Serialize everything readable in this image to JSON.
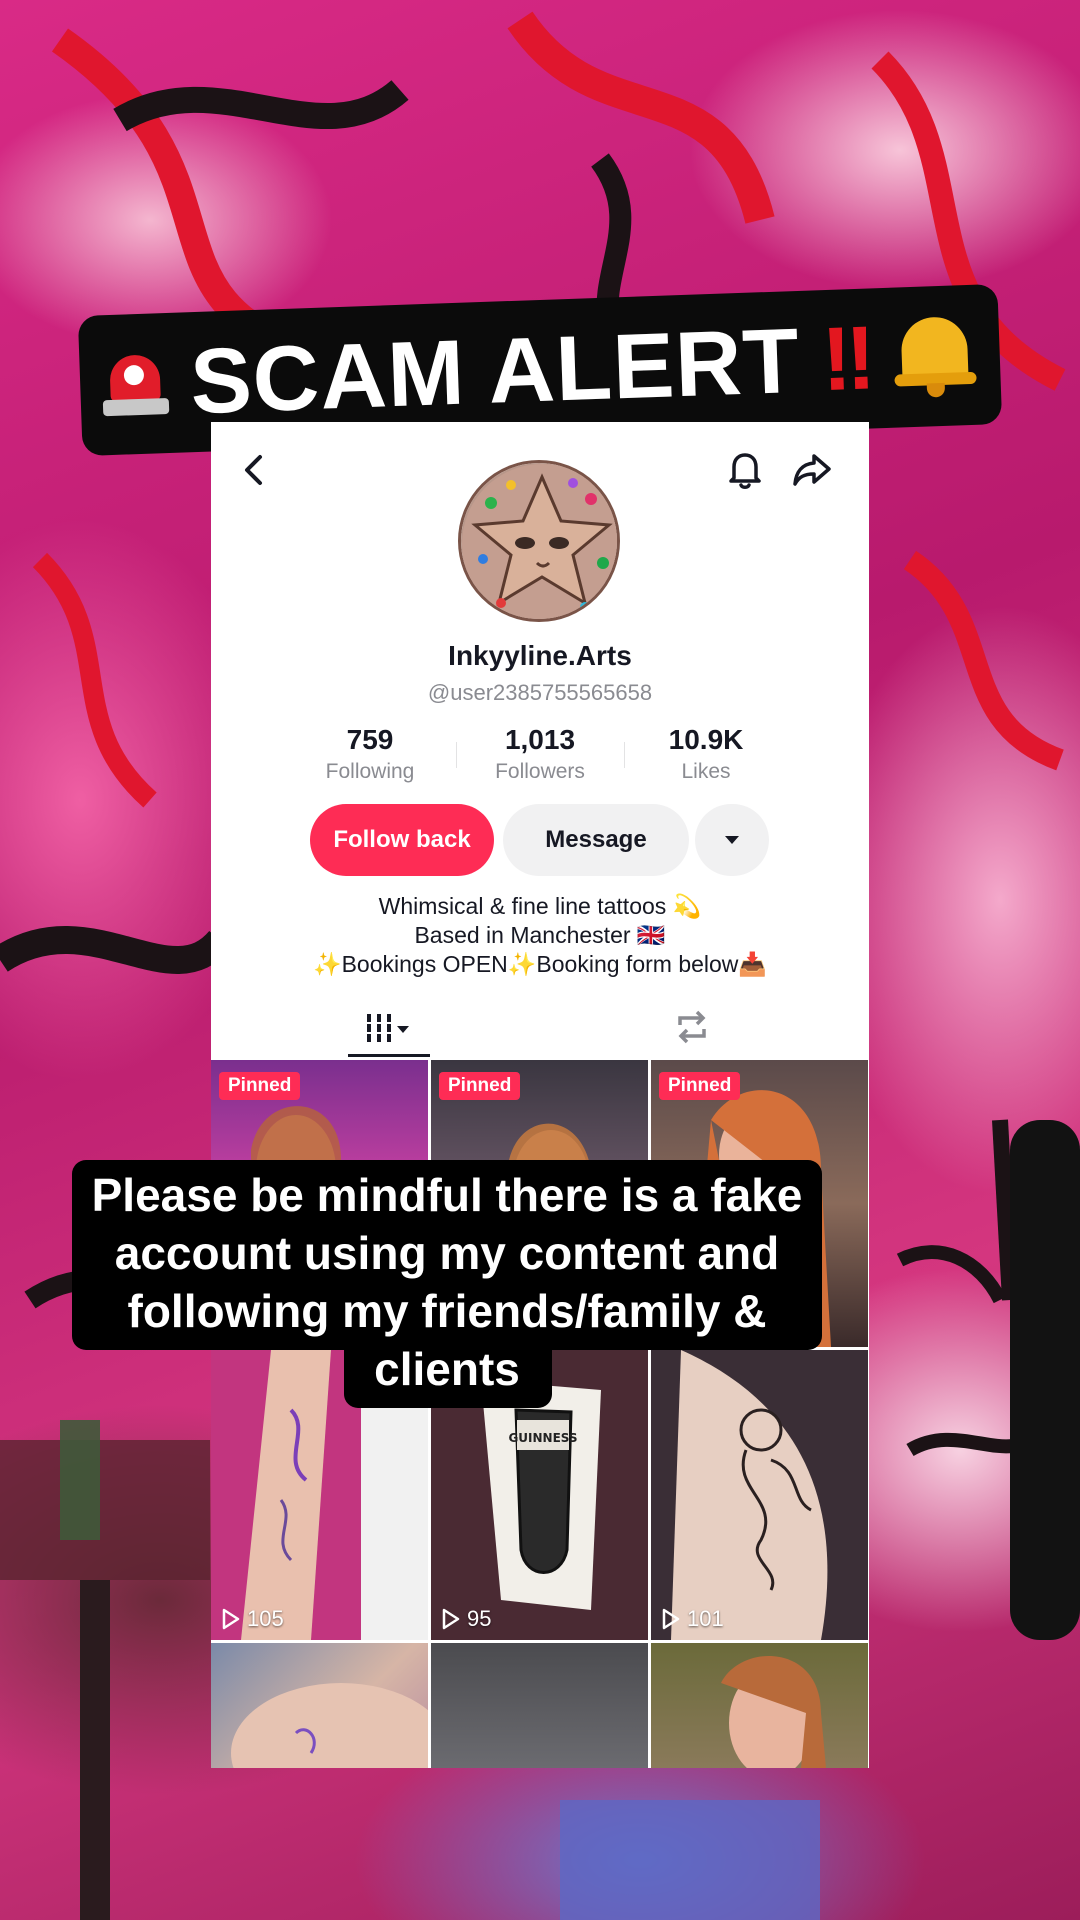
{
  "overlay": {
    "banner_title": "SCAM ALERT",
    "banner_exclaim": "!!",
    "caption": "Please be mindful there is a fake account using my content and following my friends/family & clients"
  },
  "profile": {
    "display_name": "Inkyyline.Arts",
    "handle": "@user2385755565658",
    "stats": [
      {
        "value": "759",
        "label": "Following"
      },
      {
        "value": "1,013",
        "label": "Followers"
      },
      {
        "value": "10.9K",
        "label": "Likes"
      }
    ],
    "buttons": {
      "follow": "Follow back",
      "message": "Message"
    },
    "bio": [
      "Whimsical & fine line tattoos 💫",
      "Based in Manchester 🇬🇧",
      "✨Bookings OPEN✨Booking form below📥"
    ]
  },
  "grid": {
    "pinned_label": "Pinned",
    "videos": [
      {
        "pinned": true,
        "views": ""
      },
      {
        "pinned": true,
        "views": ""
      },
      {
        "pinned": true,
        "views": ""
      },
      {
        "pinned": false,
        "views": "105"
      },
      {
        "pinned": false,
        "views": "95"
      },
      {
        "pinned": false,
        "views": "101"
      },
      {
        "pinned": false,
        "views": ""
      },
      {
        "pinned": false,
        "views": ""
      },
      {
        "pinned": false,
        "views": ""
      }
    ],
    "thumbnail_text": "GUINNESS"
  },
  "colors": {
    "accent": "#fe2c55",
    "banner_bg": "#0b0b0b",
    "alarm_red": "#e3171f"
  }
}
